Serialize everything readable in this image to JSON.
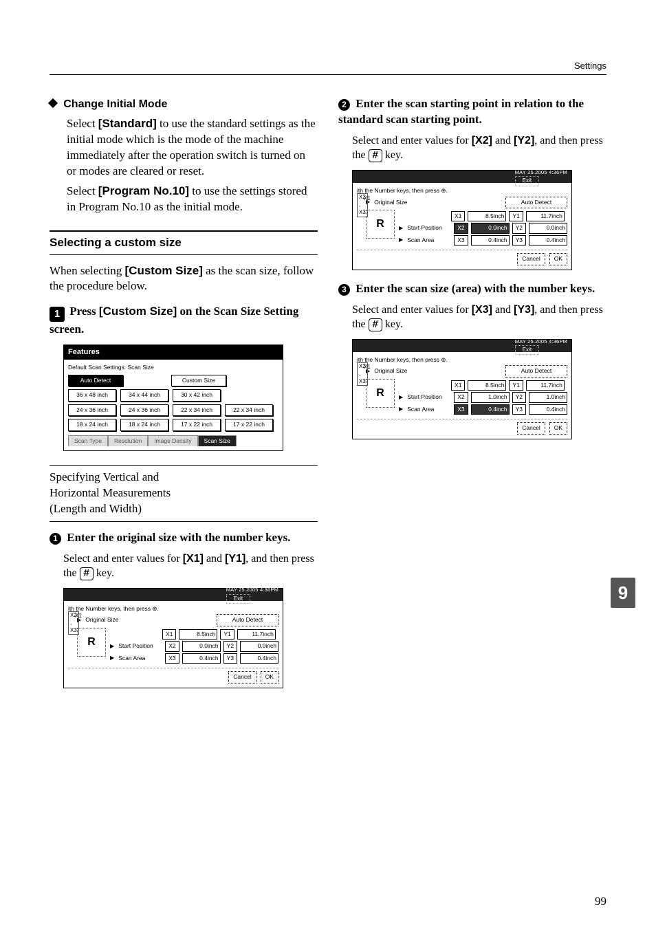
{
  "header": {
    "section": "Settings"
  },
  "page_number": "99",
  "chapter_tab": "9",
  "left": {
    "change_mode": {
      "title": "Change Initial Mode",
      "para1a": "Select ",
      "standard": "[Standard]",
      "para1b": " to use the standard settings as the initial mode which is the mode of the machine immediately after the operation switch is turned on or modes are cleared or reset.",
      "para2a": "Select ",
      "program": "[Program No.10]",
      "para2b": " to use the settings stored in Program No.10 as the initial mode."
    },
    "custom_heading": "Selecting a custom size",
    "custom_para_a": "When selecting ",
    "custom_bold": "[Custom Size]",
    "custom_para_b": " as the scan size, follow the procedure below.",
    "step1": {
      "num": "1",
      "text_a": "Press ",
      "text_bold": "[Custom Size]",
      "text_b": " on the Scan Size Setting screen."
    },
    "subhead": {
      "line1": "Specifying Vertical and",
      "line2": "Horizontal Measurements",
      "line3": "(Length and Width)"
    },
    "sub1": {
      "num": "1",
      "title": "Enter the original size with the number keys.",
      "desc_a": "Select and enter values for ",
      "x1": "[X1]",
      "desc_b": " and ",
      "y1": "[Y1]",
      "desc_c": ", and then press the ",
      "hash": "#",
      "desc_d": " key."
    }
  },
  "right": {
    "sub2": {
      "num": "2",
      "title": "Enter the scan starting point in relation to the standard scan starting point.",
      "desc_a": "Select and enter values for ",
      "x2": "[X2]",
      "desc_b": " and ",
      "y2": "[Y2]",
      "desc_c": ", and then press the ",
      "hash": "#",
      "desc_d": " key."
    },
    "sub3": {
      "num": "3",
      "title": "Enter the scan size (area) with the number keys.",
      "desc_a": "Select and enter values for ",
      "x3": "[X3]",
      "desc_b": " and ",
      "y3": "[Y3]",
      "desc_c": ", and then press the ",
      "hash": "#",
      "desc_d": " key."
    }
  },
  "shot_features": {
    "title": "Features",
    "caption": "Default Scan Settings: Scan Size",
    "auto": "Auto Detect",
    "custom": "Custom Size",
    "sizes_r1": [
      "36 x 48  inch",
      "34 x 44  inch",
      "30 x 42  inch"
    ],
    "sizes_r2": [
      "24 x 36  inch",
      "24 x 36  inch",
      "22 x 34  inch",
      "22 x 34  inch"
    ],
    "sizes_r3": [
      "18 x 24  inch",
      "18 x 24  inch",
      "17 x 22  inch",
      "17 x 22  inch"
    ],
    "tabs": [
      "Scan Type",
      "Resolution",
      "Image Density",
      "Scan Size"
    ]
  },
  "shot_common": {
    "clock": "MAY   25.2005  4:36PM",
    "exit": "Exit",
    "hint": "ith the Number keys, then press ",
    "orig": "Original Size",
    "start": "Start Position",
    "area": "Scan Area",
    "auto": "Auto Detect",
    "cancel": "Cancel",
    "ok": "OK",
    "R": "R",
    "x1": "X1",
    "x2": "X2",
    "x3": "X3",
    "y1": "Y1",
    "y2": "Y2",
    "y3": "Y3"
  },
  "shot1_vals": {
    "x1": "8.5inch",
    "y1": "11.7inch",
    "x2": "0.0inch",
    "y2": "0.0inch",
    "x3": "0.4inch",
    "y3": "0.4inch"
  },
  "shot2_vals": {
    "x1": "8.5inch",
    "y1": "11.7inch",
    "x2": "0.0inch",
    "y2": "0.0inch",
    "x3": "0.4inch",
    "y3": "0.4inch"
  },
  "shot3_vals": {
    "x1": "8.5inch",
    "y1": "11.7inch",
    "x2": "1.0inch",
    "y2": "1.0inch",
    "x3": "0.4inch",
    "y3": "0.4inch"
  }
}
